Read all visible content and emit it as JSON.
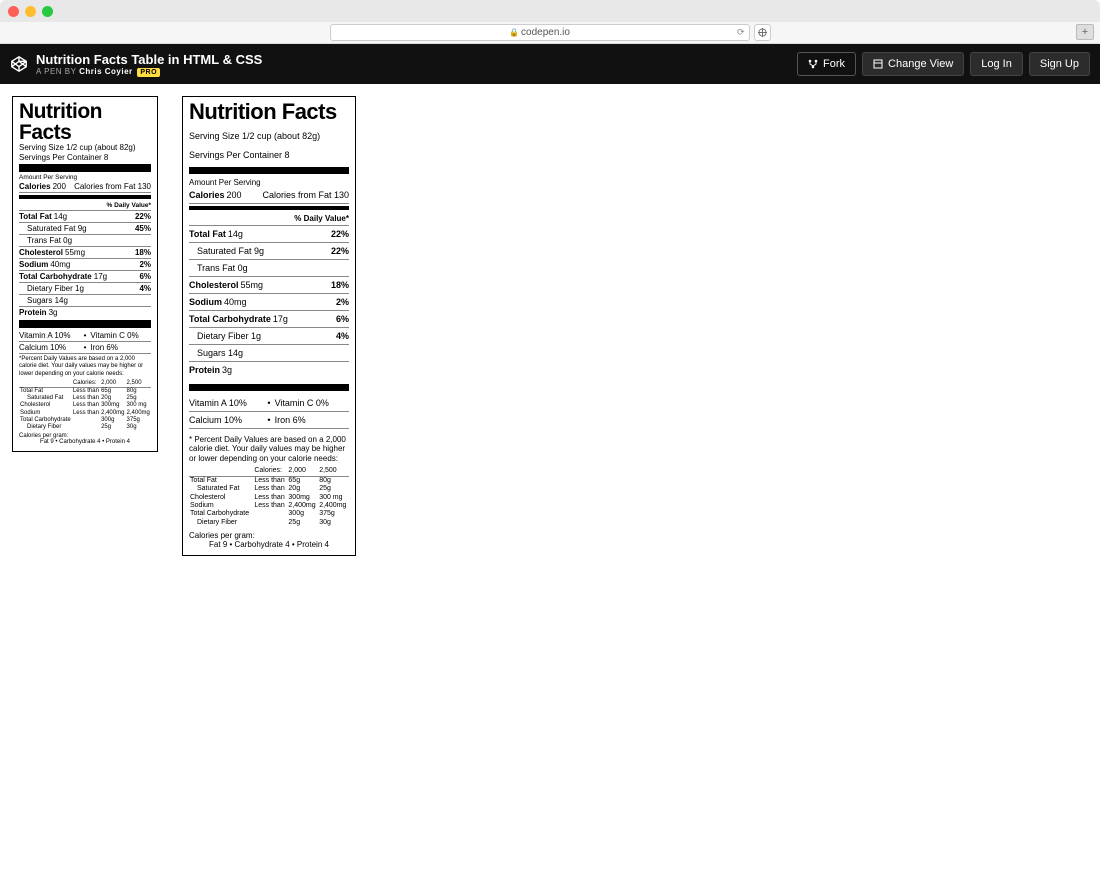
{
  "browser": {
    "url": "codepen.io",
    "tab_plus": "+"
  },
  "header": {
    "title": "Nutrition Facts Table in HTML & CSS",
    "pen_by": "A PEN BY",
    "author": "Chris Coyier",
    "pro": "PRO",
    "fork": "Fork",
    "change_view": "Change View",
    "log_in": "Log In",
    "sign_up": "Sign Up"
  },
  "nf": {
    "title": "Nutrition Facts",
    "serving_size": "Serving Size 1/2 cup (about 82g)",
    "servings_per": "Servings Per Container 8",
    "aps": "Amount Per Serving",
    "cal_lbl": "Calories",
    "cal_val": "200",
    "calfat_lbl": "Calories from Fat",
    "calfat_val": "130",
    "dv_hdr": "% Daily Value*",
    "rows": [
      {
        "b": "Total Fat",
        "v": "14g",
        "p": "22%",
        "ind": 0
      },
      {
        "b": "",
        "l": "Saturated Fat 9g",
        "p": "45%",
        "ind": 1,
        "pA": "22%"
      },
      {
        "b": "",
        "l": "Trans Fat 0g",
        "p": "",
        "ind": 1
      },
      {
        "b": "Cholesterol",
        "v": "55mg",
        "p": "18%",
        "ind": 0
      },
      {
        "b": "Sodium",
        "v": "40mg",
        "p": "2%",
        "ind": 0
      },
      {
        "b": "Total Carbohydrate",
        "v": "17g",
        "p": "6%",
        "ind": 0
      },
      {
        "b": "",
        "l": "Dietary Fiber 1g",
        "p": "4%",
        "ind": 1
      },
      {
        "b": "",
        "l": "Sugars 14g",
        "p": "",
        "ind": 1
      },
      {
        "b": "Protein",
        "v": "3g",
        "p": "",
        "ind": 0
      }
    ],
    "vit": [
      {
        "a": "Vitamin A 10%",
        "b": "Vitamin C 0%"
      },
      {
        "a": "Calcium 10%",
        "b": "Iron 6%"
      }
    ],
    "foot": "*Percent Daily Values are based on a 2,000 calorie diet. Your daily values may be higher or lower depending on your calorie needs:",
    "foot2": "* Percent Daily Values are based on a 2,000 calorie diet. Your daily values may be higher or lower depending on your calorie needs:",
    "mini_hdr": [
      "",
      "Calories:",
      "2,000",
      "2,500"
    ],
    "mini": [
      [
        "Total Fat",
        "Less than",
        "65g",
        "80g",
        0
      ],
      [
        "Saturated Fat",
        "Less than",
        "20g",
        "25g",
        1
      ],
      [
        "Cholesterol",
        "Less than",
        "300mg",
        "300 mg",
        0
      ],
      [
        "Sodium",
        "Less than",
        "2,400mg",
        "2,400mg",
        0
      ],
      [
        "Total Carbohydrate",
        "",
        "300g",
        "375g",
        0
      ],
      [
        "Dietary Fiber",
        "",
        "25g",
        "30g",
        1
      ]
    ],
    "cpg": "Calories per gram:",
    "cpg2a": "Fat 9  •  Carbohydrate 4  •  Protein 4",
    "cpg2b": "Fat 9 • Carbohydrate 4 • Protein 4"
  }
}
